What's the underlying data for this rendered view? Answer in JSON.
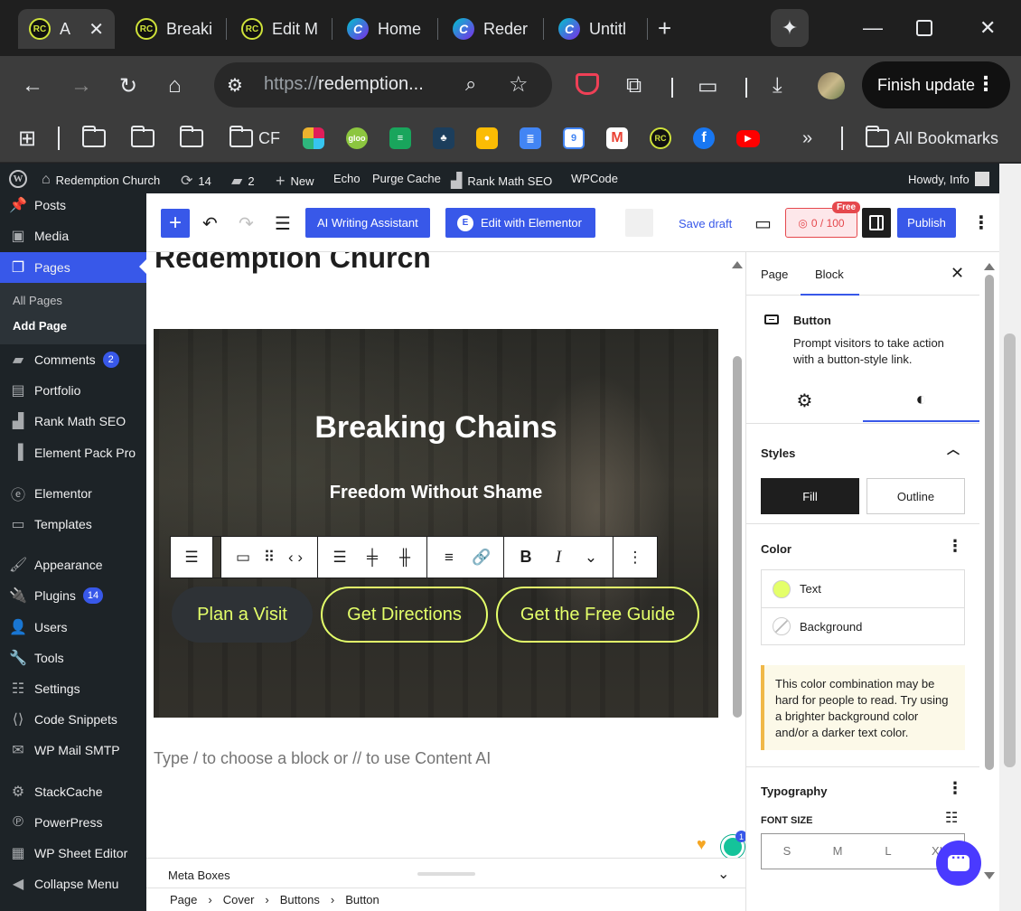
{
  "browser": {
    "tabs": [
      {
        "title": "A",
        "favicon": "rc-favicon",
        "active": true
      },
      {
        "title": "Breaki",
        "favicon": "rc-favicon"
      },
      {
        "title": "Edit M",
        "favicon": "rc-favicon"
      },
      {
        "title": "Home",
        "favicon": "canva-favicon"
      },
      {
        "title": "Reder",
        "favicon": "canva-favicon"
      },
      {
        "title": "Untitl",
        "favicon": "canva-favicon"
      }
    ],
    "url_prefix": "https://",
    "url_host": "redemption...",
    "finish_update_label": "Finish update",
    "bookmarks": {
      "cf_label": "CF",
      "all_bookmarks_label": "All Bookmarks",
      "gloo_label": "gloo",
      "calendar_label": "9",
      "rc_label": "RC"
    }
  },
  "adminbar": {
    "site_name": "Redemption Church",
    "updates_count": "14",
    "comments_count": "2",
    "new_label": "New",
    "echo_label": "Echo",
    "purge_label": "Purge Cache",
    "rankmath_label": "Rank Math SEO",
    "wpcode_label": "WPCode",
    "howdy": "Howdy, Info"
  },
  "sidebar": {
    "items": [
      {
        "label": "Posts",
        "icon": "pin-icon"
      },
      {
        "label": "Media",
        "icon": "media-icon"
      },
      {
        "label": "Pages",
        "icon": "pages-icon",
        "current": true
      },
      {
        "label": "Comments",
        "icon": "comment-icon",
        "badge": "2"
      },
      {
        "label": "Portfolio",
        "icon": "portfolio-icon"
      },
      {
        "label": "Rank Math SEO",
        "icon": "chart-icon"
      },
      {
        "label": "Element Pack Pro",
        "icon": "element-pack-icon"
      },
      {
        "label": "Elementor",
        "icon": "elementor-icon"
      },
      {
        "label": "Templates",
        "icon": "folder-icon"
      },
      {
        "label": "Appearance",
        "icon": "brush-icon"
      },
      {
        "label": "Plugins",
        "icon": "plugin-icon",
        "badge": "14"
      },
      {
        "label": "Users",
        "icon": "user-icon"
      },
      {
        "label": "Tools",
        "icon": "wrench-icon"
      },
      {
        "label": "Settings",
        "icon": "settings-icon"
      },
      {
        "label": "Code Snippets",
        "icon": "code-icon"
      },
      {
        "label": "WP Mail SMTP",
        "icon": "mail-icon"
      },
      {
        "label": "StackCache",
        "icon": "gear-icon"
      },
      {
        "label": "PowerPress",
        "icon": "podcast-icon"
      },
      {
        "label": "WP Sheet Editor",
        "icon": "sheet-icon"
      },
      {
        "label": "Collapse Menu",
        "icon": "collapse-icon"
      }
    ],
    "submenu": {
      "all_pages": "All Pages",
      "add_page": "Add Page"
    }
  },
  "editor": {
    "ai_assistant_label": "AI Writing Assistant",
    "elementor_label": "Edit with Elementor",
    "elementor_logo_letter": "E",
    "save_draft_label": "Save draft",
    "seo_score": "0 / 100",
    "free_badge": "Free",
    "publish_label": "Publish",
    "page_title": "Redemption Church",
    "cover_title": "Breaking Chains",
    "cover_subtitle": "Freedom Without Shame",
    "buttons": [
      "Plan a Visit",
      "Get Directions",
      "Get the Free Guide"
    ],
    "block_placeholder": "Type / to choose a block or // to use Content AI",
    "meta_boxes_label": "Meta Boxes",
    "breadcrumbs": [
      "Page",
      "Cover",
      "Buttons",
      "Button"
    ],
    "grammarly_count": "1"
  },
  "inspector": {
    "tabs": [
      "Page",
      "Block"
    ],
    "block_name": "Button",
    "block_description": "Prompt visitors to take action with a button-style link.",
    "styles_title": "Styles",
    "style_options": [
      "Fill",
      "Outline"
    ],
    "color_title": "Color",
    "color_text_label": "Text",
    "color_background_label": "Background",
    "text_color": "#e4ff6a",
    "contrast_notice": "This color combination may be hard for people to read. Try using a brighter background color and/or a darker text color.",
    "typography_title": "Typography",
    "font_size_label": "FONT SIZE",
    "font_sizes": [
      "S",
      "M",
      "L",
      "XL"
    ]
  },
  "colors": {
    "accent": "#3858e9",
    "button_text": "#e4ff6a",
    "admin_bg": "#1d2327"
  }
}
